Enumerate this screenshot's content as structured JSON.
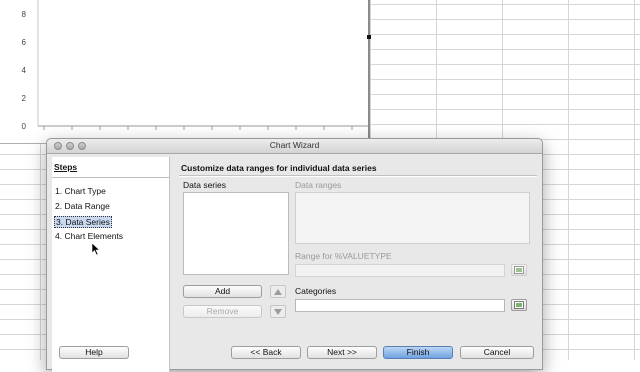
{
  "sheet": {
    "chart": {
      "y_tick_labels": [
        "8",
        "6",
        "4",
        "2",
        "0"
      ],
      "x_axis_ticks": 12
    }
  },
  "dialog": {
    "title": "Chart Wizard",
    "steps": {
      "heading": "Steps",
      "items": [
        {
          "label": "1. Chart Type",
          "active": false
        },
        {
          "label": "2. Data Range",
          "active": false
        },
        {
          "label": "3. Data Series",
          "active": true
        },
        {
          "label": "4. Chart Elements",
          "active": false
        }
      ]
    },
    "content": {
      "section_title": "Customize data ranges for individual data series",
      "data_series_label": "Data series",
      "data_ranges_label": "Data ranges",
      "range_for_label": "Range for %VALUETYPE",
      "range_for_value": "",
      "categories_label": "Categories",
      "categories_value": "",
      "add_label": "Add",
      "remove_label": "Remove",
      "up_icon": "up-arrow-icon",
      "down_icon": "down-arrow-icon"
    },
    "buttons": {
      "help": "Help",
      "back": "<< Back",
      "next": "Next >>",
      "finish": "Finish",
      "cancel": "Cancel"
    }
  }
}
